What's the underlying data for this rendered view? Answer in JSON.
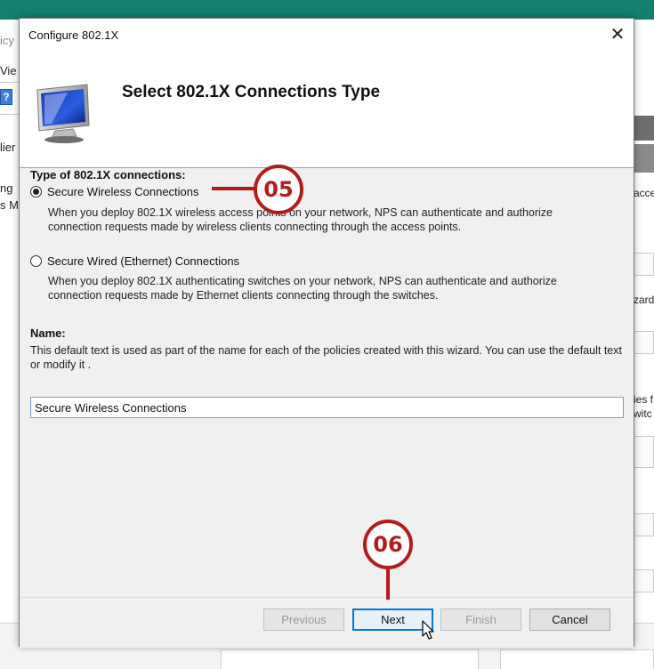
{
  "background": {
    "left_fragments": [
      "icy",
      "Vie",
      "?",
      "lier",
      "ng",
      "s M"
    ],
    "right_fragments": [
      "acce",
      "zard",
      "ies f",
      "witc"
    ]
  },
  "dialog": {
    "title": "Configure 802.1X",
    "close_symbol": "✕",
    "header_title": "Select 802.1X Connections Type",
    "header_icon": "monitor-icon"
  },
  "connection_type": {
    "section_label": "Type of 802.1X connections:",
    "options": [
      {
        "label": "Secure Wireless Connections",
        "checked": true,
        "description": "When you deploy 802.1X wireless access points on your network, NPS can authenticate and authorize connection requests made by wireless clients connecting through the access points."
      },
      {
        "label": "Secure Wired (Ethernet) Connections",
        "checked": false,
        "description": "When you deploy 802.1X authenticating switches on your network, NPS can authenticate and authorize connection requests made by Ethernet clients connecting through the switches."
      }
    ]
  },
  "name_section": {
    "label": "Name:",
    "help": "This default text is used as part of the name for each of the policies created with this wizard. You can use the default text or modify it .",
    "value": "Secure Wireless Connections"
  },
  "buttons": {
    "previous": "Previous",
    "next": "Next",
    "finish": "Finish",
    "cancel": "Cancel"
  },
  "annotations": {
    "step_05": "05",
    "step_06": "06",
    "color": "#b41c1c"
  }
}
